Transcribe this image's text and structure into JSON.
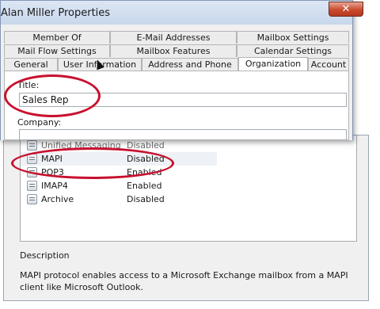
{
  "window": {
    "title": "Alan Miller Properties",
    "close_glyph": "✕"
  },
  "tabs": {
    "row1": [
      "Member Of",
      "E-Mail Addresses",
      "Mailbox Settings"
    ],
    "row2": [
      "Mail Flow Settings",
      "Mailbox Features",
      "Calendar Settings"
    ],
    "row3": [
      "General",
      "User Information",
      "Address and Phone",
      "Organization",
      "Account"
    ],
    "active": "Organization"
  },
  "organization": {
    "title_label": "Title:",
    "title_value": "Sales Rep",
    "company_label": "Company:",
    "company_value": ""
  },
  "features": [
    {
      "name": "Unified Messaging",
      "status": "Disabled"
    },
    {
      "name": "MAPI",
      "status": "Disabled",
      "selected": true
    },
    {
      "name": "POP3",
      "status": "Enabled"
    },
    {
      "name": "IMAP4",
      "status": "Enabled"
    },
    {
      "name": "Archive",
      "status": "Disabled"
    }
  ],
  "description": {
    "label": "Description",
    "text": "MAPI protocol enables access to a Microsoft Exchange mailbox from a MAPI client like Microsoft Outlook."
  },
  "colors": {
    "annotation": "#c8102e",
    "accent": "#8296b3"
  }
}
